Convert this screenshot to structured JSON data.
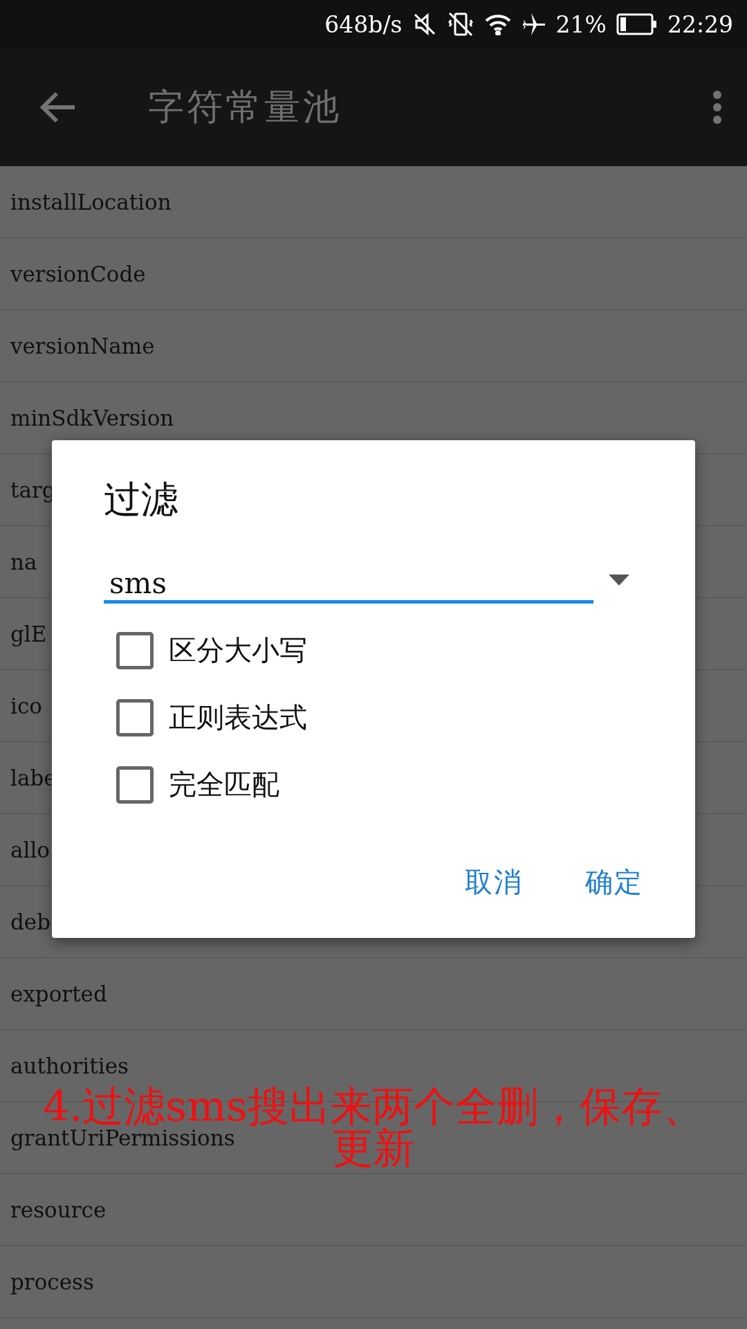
{
  "status_bar": {
    "net_speed": "648b/s",
    "battery": "21%",
    "time": "22:29"
  },
  "app_bar": {
    "title": "字符常量池"
  },
  "list": {
    "items": [
      "installLocation",
      "versionCode",
      "versionName",
      "minSdkVersion",
      "targ",
      "na",
      "glE",
      "ico",
      "labe",
      "allo",
      "deb",
      "exported",
      "authorities",
      "grantUriPermissions",
      "resource",
      "process"
    ]
  },
  "dialog": {
    "title": "过滤",
    "field": {
      "value": "sms"
    },
    "options": [
      {
        "label": "区分大小写",
        "checked": false
      },
      {
        "label": "正则表达式",
        "checked": false
      },
      {
        "label": "完全匹配",
        "checked": false
      }
    ],
    "buttons": [
      "取消",
      "确定"
    ]
  },
  "annotation": {
    "lines": [
      "4.过滤sms搜出来两个全删，保存、",
      "更新"
    ]
  }
}
